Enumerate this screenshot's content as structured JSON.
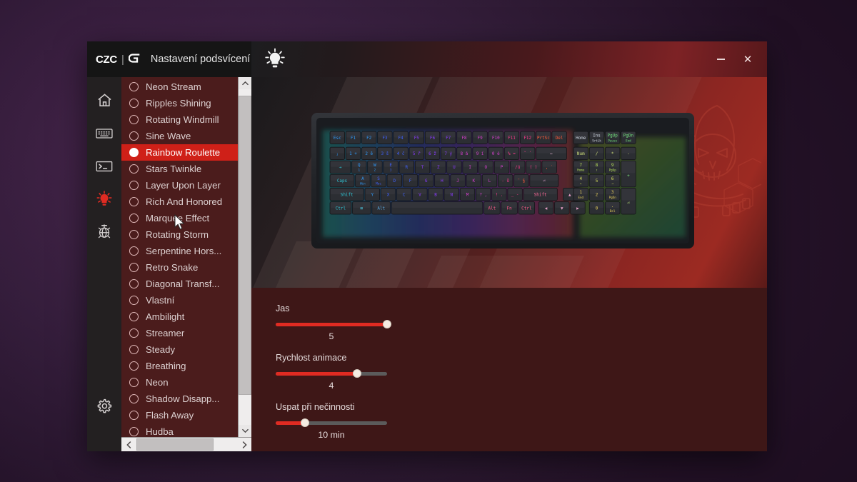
{
  "window": {
    "brand_czc": "CZC",
    "brand_sep": "|",
    "brand_g": "G",
    "title": "Nastavení podsvícení",
    "bulb_icon": "lightbulb-icon",
    "minimize_label": "",
    "close_label": "✕"
  },
  "rail": {
    "items": [
      {
        "name": "home-icon",
        "label": "Domů",
        "active": false
      },
      {
        "name": "keyboard-icon",
        "label": "Klávesnice",
        "active": false
      },
      {
        "name": "macro-terminal-icon",
        "label": "Makra",
        "active": false
      },
      {
        "name": "lightbulb-icon",
        "label": "Podsvícení",
        "active": true
      },
      {
        "name": "fan-globe-icon",
        "label": "Ostatní",
        "active": false
      }
    ],
    "settings": {
      "name": "gear-icon",
      "label": "Nastavení"
    }
  },
  "effect_list": {
    "selected": "Rainbow Roulette",
    "items": [
      "Neon Stream",
      "Ripples Shining",
      "Rotating Windmill",
      "Sine Wave",
      "Rainbow Roulette",
      "Stars Twinkle",
      "Layer Upon Layer",
      "Rich And Honored",
      "Marquee Effect",
      "Rotating Storm",
      "Serpentine Hors...",
      "Retro Snake",
      "Diagonal Transf...",
      "Vlastní",
      "Ambilight",
      "Streamer",
      "Steady",
      "Breathing",
      "Neon",
      "Shadow Disapp...",
      "Flash Away",
      "Hudba"
    ],
    "scroll_up_icon": "chevron-up-icon",
    "scroll_down_icon": "chevron-down-icon",
    "scroll_left_icon": "chevron-left-icon",
    "scroll_right_icon": "chevron-right-icon"
  },
  "sliders": [
    {
      "label": "Jas",
      "value": "5",
      "percent": 100
    },
    {
      "label": "Rychlost animace",
      "value": "4",
      "percent": 73
    },
    {
      "label": "Uspat při nečinnosti",
      "value": "10 min",
      "percent": 26
    }
  ],
  "preview": {
    "keyboard_alt": "RGB mechanical keyboard preview",
    "skull_alt": "grim-reaper-logo"
  },
  "colors": {
    "accent_red": "#e02b22",
    "selected_red": "#cf2018",
    "list_bg": "#4b1c1c",
    "panel_bg": "#3e1717",
    "rail_bg": "#232021",
    "titlebar_dark": "#151515"
  }
}
